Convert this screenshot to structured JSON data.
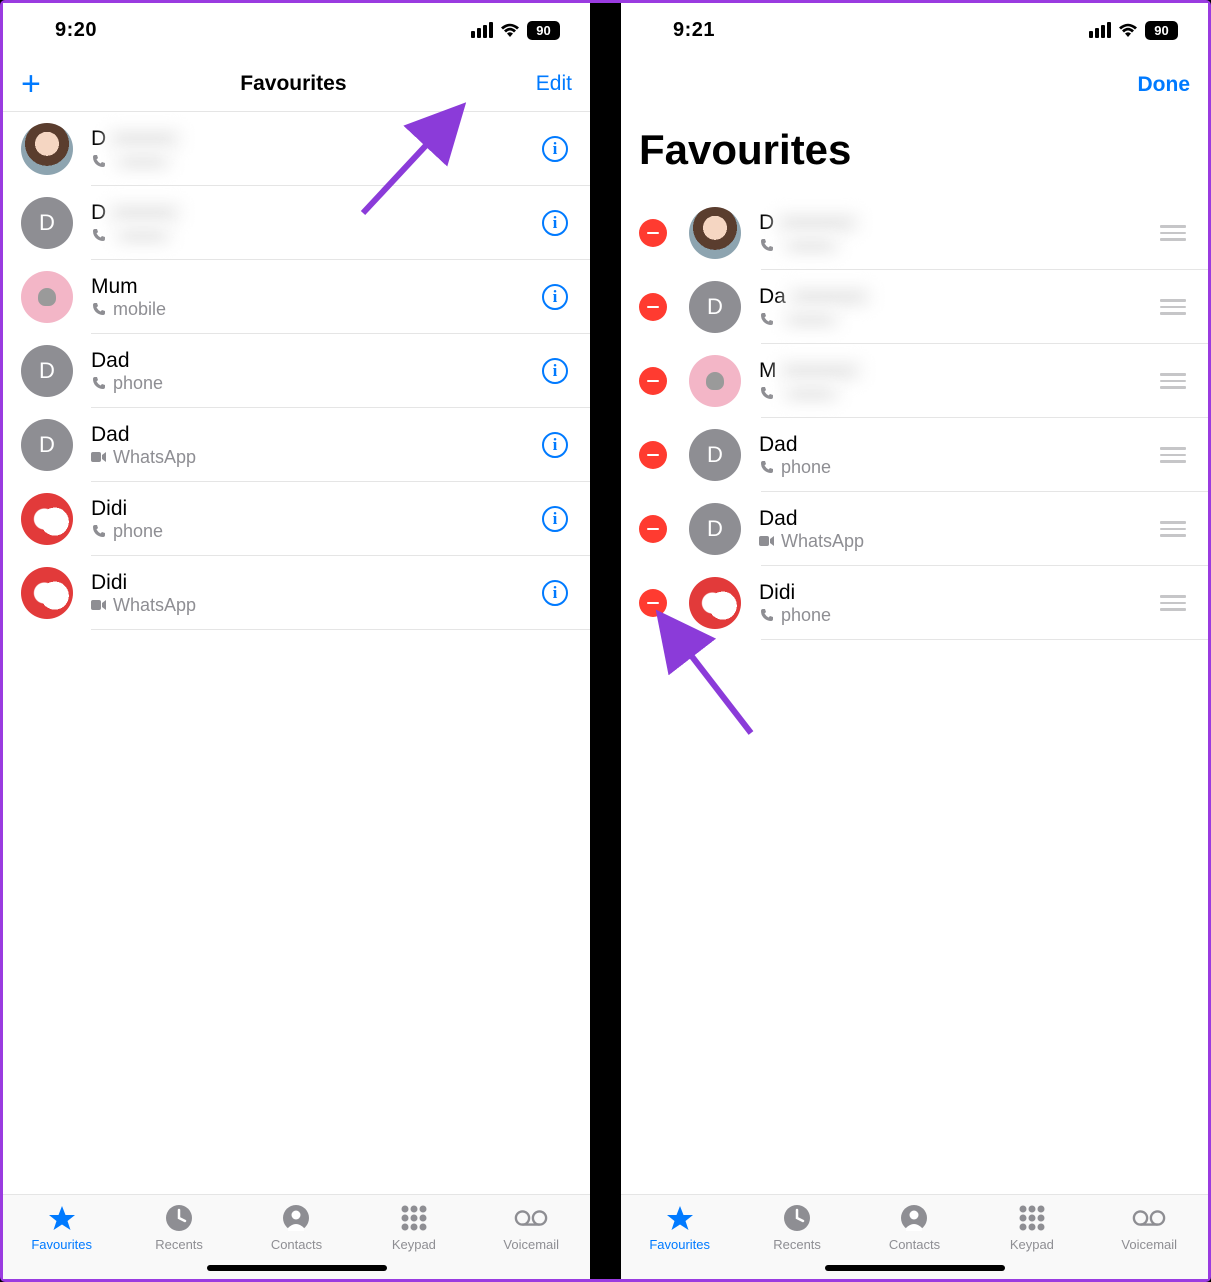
{
  "left": {
    "status": {
      "time": "9:20",
      "battery": "90"
    },
    "nav": {
      "title": "Favourites",
      "edit": "Edit"
    },
    "rows": [
      {
        "name": "D",
        "sub": "",
        "subIcon": "phone",
        "avatar": "img1",
        "blur": true
      },
      {
        "name": "D",
        "sub": "",
        "subIcon": "phone",
        "avatar": "grey",
        "letter": "D",
        "blur": true
      },
      {
        "name": "Mum",
        "sub": "mobile",
        "subIcon": "phone",
        "avatar": "pink"
      },
      {
        "name": "Dad",
        "sub": "phone",
        "subIcon": "phone",
        "avatar": "grey",
        "letter": "D"
      },
      {
        "name": "Dad",
        "sub": "WhatsApp",
        "subIcon": "video",
        "avatar": "grey",
        "letter": "D"
      },
      {
        "name": "Didi",
        "sub": "phone",
        "subIcon": "phone",
        "avatar": "red"
      },
      {
        "name": "Didi",
        "sub": "WhatsApp",
        "subIcon": "video",
        "avatar": "red"
      }
    ]
  },
  "right": {
    "status": {
      "time": "9:21",
      "battery": "90"
    },
    "done": "Done",
    "title": "Favourites",
    "rows": [
      {
        "name": "D",
        "sub": "",
        "subIcon": "phone",
        "avatar": "img1",
        "blur": true
      },
      {
        "name": "Da",
        "sub": "",
        "subIcon": "phone",
        "avatar": "grey",
        "letter": "D",
        "blur": true
      },
      {
        "name": "M",
        "sub": "",
        "subIcon": "phone",
        "avatar": "pink",
        "blur": true
      },
      {
        "name": "Dad",
        "sub": "phone",
        "subIcon": "phone",
        "avatar": "grey",
        "letter": "D"
      },
      {
        "name": "Dad",
        "sub": "WhatsApp",
        "subIcon": "video",
        "avatar": "grey",
        "letter": "D"
      },
      {
        "name": "Didi",
        "sub": "phone",
        "subIcon": "phone",
        "avatar": "red"
      }
    ]
  },
  "tabs": [
    {
      "id": "favourites",
      "label": "Favourites"
    },
    {
      "id": "recents",
      "label": "Recents"
    },
    {
      "id": "contacts",
      "label": "Contacts"
    },
    {
      "id": "keypad",
      "label": "Keypad"
    },
    {
      "id": "voicemail",
      "label": "Voicemail"
    }
  ]
}
